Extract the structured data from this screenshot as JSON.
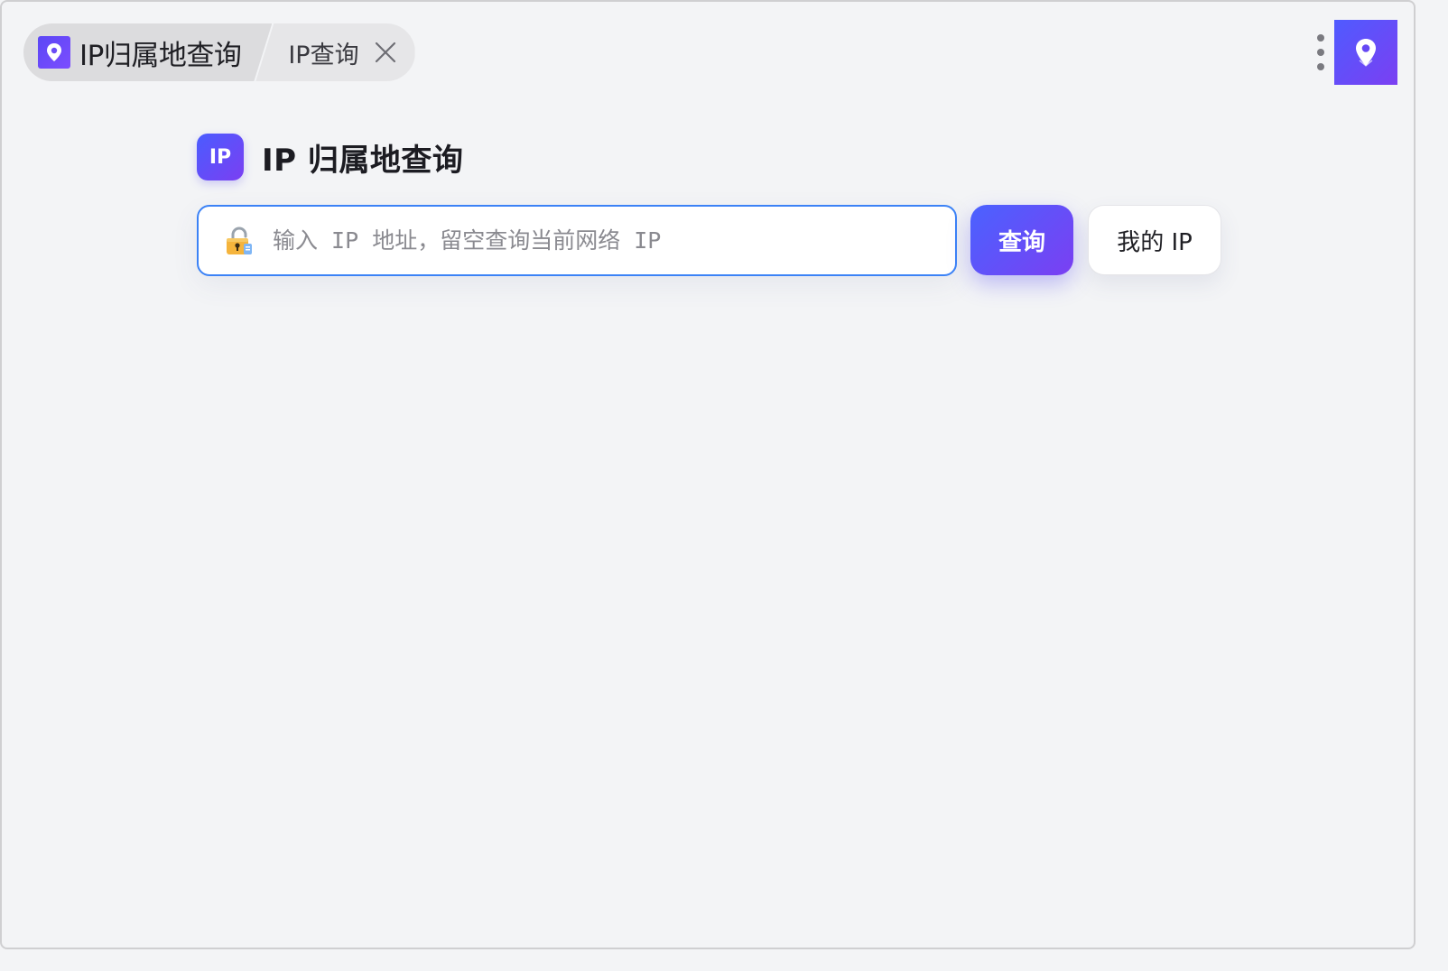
{
  "tabs": {
    "main_label": "IP归属地查询",
    "sub_label": "IP查询"
  },
  "app": {
    "title": "IP 归属地查询",
    "badge_text": "IP"
  },
  "search": {
    "value": "",
    "placeholder": "输入 IP 地址，留空查询当前网络 IP"
  },
  "buttons": {
    "query_label": "查询",
    "my_ip_label": "我的 IP"
  },
  "icons": {
    "tab_logo": "location-pin-icon",
    "close": "close-icon",
    "menu": "more-vertical-icon",
    "app": "location-pin-icon",
    "search_prefix": "lock-icon"
  },
  "colors": {
    "accent_start": "#4a62ff",
    "accent_end": "#7b3ff2",
    "input_border": "#3b82f6",
    "background": "#f3f4f6"
  }
}
